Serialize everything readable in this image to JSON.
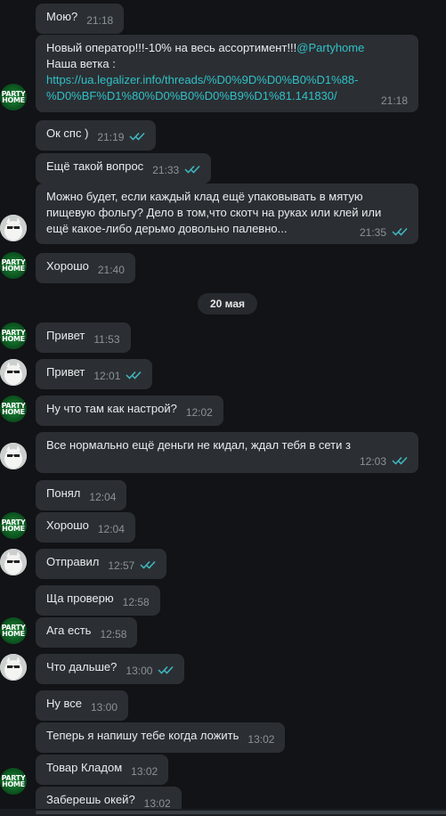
{
  "date_separator": "20 мая",
  "messages": [
    {
      "text": "Мою?",
      "time": "21:18"
    },
    {
      "line1": "Новый оператор!!!-10% на весь ассортимент!!!",
      "mention": "@Partyhome",
      "line2": "Наша ветка :",
      "link1": "https://ua.legalizer.info/threads/%D0%9D%D0%B0%D1%88-",
      "link2": "%D0%BF%D1%80%D0%B0%D0%B9%D1%81.141830/",
      "time": "21:18"
    },
    {
      "text": "Ок спс )",
      "time": "21:19"
    },
    {
      "text": "Ещё такой вопрос",
      "time": "21:33"
    },
    {
      "line1": "Можно будет, если каждый клад ещё упаковывать в мятую",
      "line2": "пищевую фольгу? Дело в том,что скотч на руках или клей или",
      "line3": "ещё какое-либо дерьмо довольно палевно...",
      "time": "21:35"
    },
    {
      "text": "Хорошо",
      "time": "21:40"
    },
    {
      "text": "Привет",
      "time": "11:53"
    },
    {
      "text": "Привет",
      "time": "12:01"
    },
    {
      "text": "Ну что там как настрой?",
      "time": "12:02"
    },
    {
      "text": "Все нормально ещё деньги не кидал, ждал тебя в сети з",
      "time": "12:03"
    },
    {
      "text": "Понял",
      "time": "12:04"
    },
    {
      "text": "Хорошо",
      "time": "12:04"
    },
    {
      "text": "Отправил",
      "time": "12:57"
    },
    {
      "text": "Ща проверю",
      "time": "12:58"
    },
    {
      "text": "Ага есть",
      "time": "12:58"
    },
    {
      "text": "Что дальше?",
      "time": "13:00"
    },
    {
      "text": "Ну все",
      "time": "13:00"
    },
    {
      "text": "Теперь я напишу тебе когда ложить",
      "time": "13:02"
    },
    {
      "text": "Товар Кладом",
      "time": "13:02"
    },
    {
      "text": "Заберешь окей?",
      "time": "13:02"
    }
  ],
  "avatar_party": {
    "line1": "PARTY",
    "line2": "HOME"
  },
  "colors": {
    "bubble": "#2b2f33",
    "link": "#2fc1c8",
    "check": "#3fb8c0",
    "background": "#111316"
  }
}
